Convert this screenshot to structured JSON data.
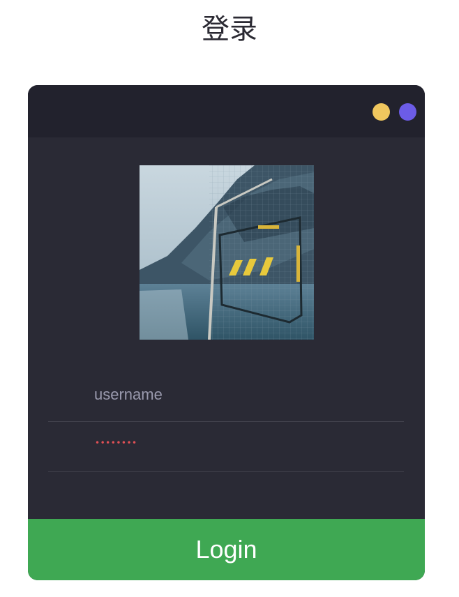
{
  "page": {
    "title": "登录"
  },
  "window": {
    "controls": [
      "yellow-dot",
      "purple-dot"
    ]
  },
  "form": {
    "username_placeholder": "username",
    "password_masked": "••••••••",
    "login_label": "Login"
  },
  "colors": {
    "card_bg": "#2a2a35",
    "header_bg": "#22222d",
    "dot_yellow": "#f0c75e",
    "dot_purple": "#6c5ce7",
    "button_bg": "#3fa853",
    "password_dots": "#e05055"
  }
}
